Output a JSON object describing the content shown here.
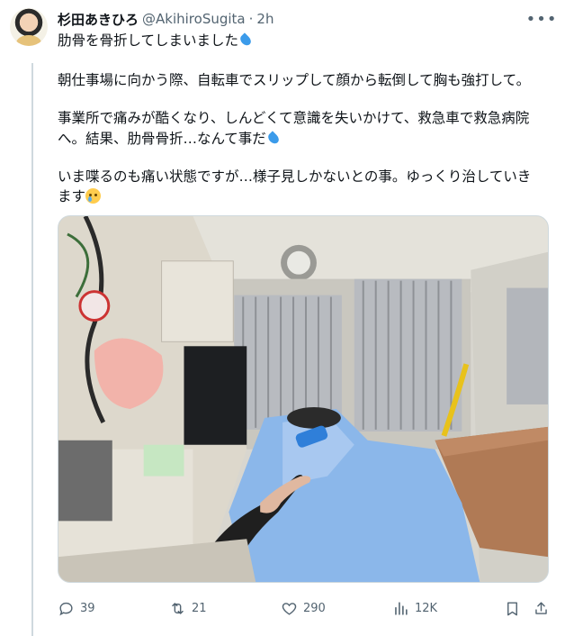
{
  "tweet": {
    "author_name": "杉田あきひろ",
    "author_handle": "@AkihiroSugita",
    "separator": "·",
    "time": "2h",
    "lines": [
      "肋骨を骨折してしまいました",
      "朝仕事場に向かう際、自転車でスリップして顔から転倒して胸も強打して。",
      "事業所で痛みが酷くなり、しんどくて意識を失いかけて、救急車で救急病院",
      "へ。結果、肋骨骨折…なんて事だ",
      "いま喋るのも痛い状態ですが…様子見しかないとの事。ゆっくり治していき",
      "ます"
    ],
    "emoji": [
      "droplet",
      "droplet",
      "crying-face"
    ]
  },
  "photo": {
    "description_icon": "ambulance-interior-photo"
  },
  "actions": {
    "reply_count": "39",
    "retweet_count": "21",
    "like_count": "290",
    "view_count": "12K",
    "icons": [
      "reply-icon",
      "retweet-icon",
      "like-icon",
      "views-icon",
      "bookmark-icon",
      "share-icon"
    ]
  },
  "colors": {
    "text": "#0f1419",
    "secondary": "#536471",
    "border": "#cfd9de",
    "droplet": "#3b9bea"
  }
}
